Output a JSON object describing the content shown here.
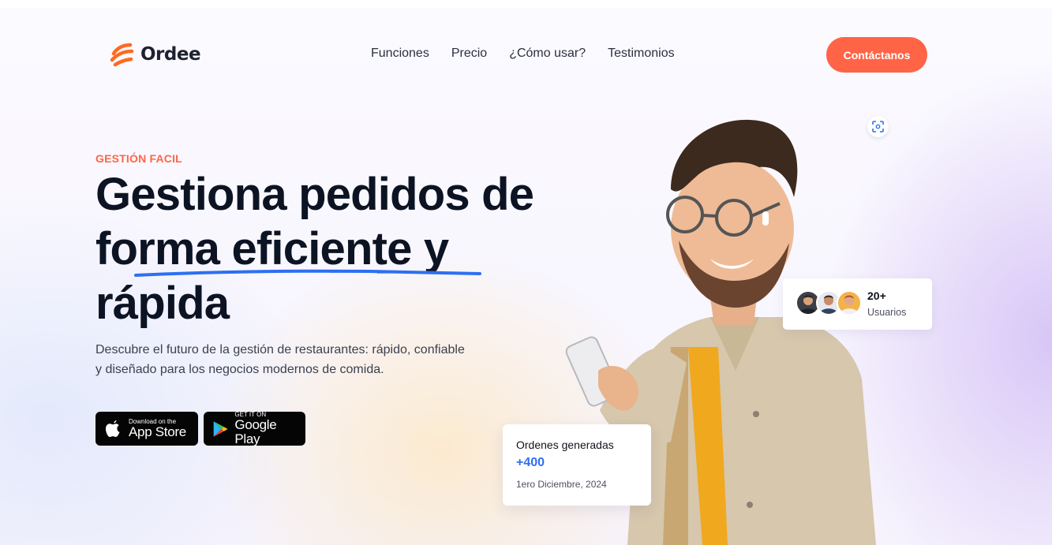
{
  "brand": {
    "name": "Ordee",
    "accent": "#ff6446",
    "highlight": "#2e6ff2"
  },
  "nav": {
    "items": [
      {
        "label": "Funciones"
      },
      {
        "label": "Precio"
      },
      {
        "label": "¿Cómo usar?"
      },
      {
        "label": "Testimonios"
      }
    ],
    "cta_label": "Contáctanos"
  },
  "hero": {
    "eyebrow": "GESTIÓN FACIL",
    "headline_lines": [
      "Gestiona pedidos de",
      "forma eficiente y",
      "rápida"
    ],
    "description": "Descubre el futuro de la gestión de restaurantes: rápido, confiable y diseñado para los negocios modernos de comida."
  },
  "stores": {
    "apple": {
      "small": "Download on the",
      "big": "App Store",
      "icon": "apple-icon"
    },
    "google": {
      "small": "GET IT ON",
      "big": "Google Play",
      "icon": "google-play-icon"
    }
  },
  "users_card": {
    "count": "20+",
    "label": "Usuarios"
  },
  "orders_card": {
    "title": "Ordenes generadas",
    "value": "+400",
    "date": "1ero Diciembre, 2024"
  },
  "icons": {
    "scan": "scan-icon"
  }
}
